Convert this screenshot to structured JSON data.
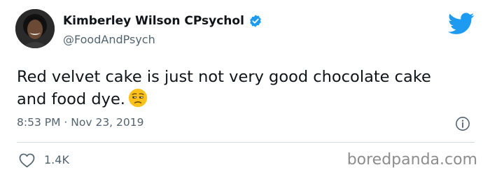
{
  "tweet": {
    "author": {
      "display_name": "Kimberley Wilson CPsychol",
      "handle": "@FoodAndPsych",
      "verified": true
    },
    "text": "Red velvet cake is just not very good chocolate cake and food dye.",
    "emoji": "unamused-face",
    "time": "8:53 PM",
    "separator": "·",
    "date": "Nov 23, 2019",
    "likes": "1.4K"
  },
  "watermark": "boredpanda.com",
  "icons": {
    "verified": "verified-badge-icon",
    "brand": "twitter-bird-icon",
    "info": "info-icon",
    "like": "heart-icon"
  },
  "colors": {
    "verified_blue": "#1d9bf0",
    "twitter_blue": "#1d9bf0",
    "secondary_text": "#536471",
    "emoji_yellow": "#fcc21b"
  }
}
